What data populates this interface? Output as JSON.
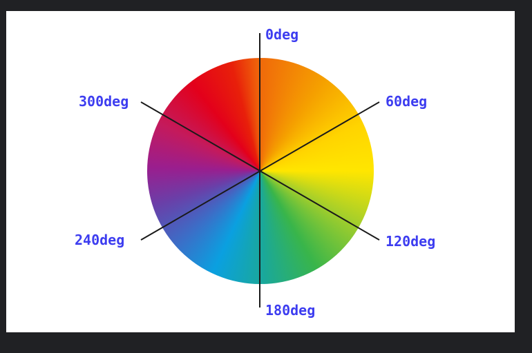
{
  "labels": {
    "deg0": "0deg",
    "deg60": "60deg",
    "deg120": "120deg",
    "deg180": "180deg",
    "deg240": "240deg",
    "deg300": "300deg"
  },
  "colors": {
    "label": "#3d3df0",
    "line": "#1a1a1a",
    "canvas_bg": "#ffffff",
    "frame_bg": "#202124"
  }
}
